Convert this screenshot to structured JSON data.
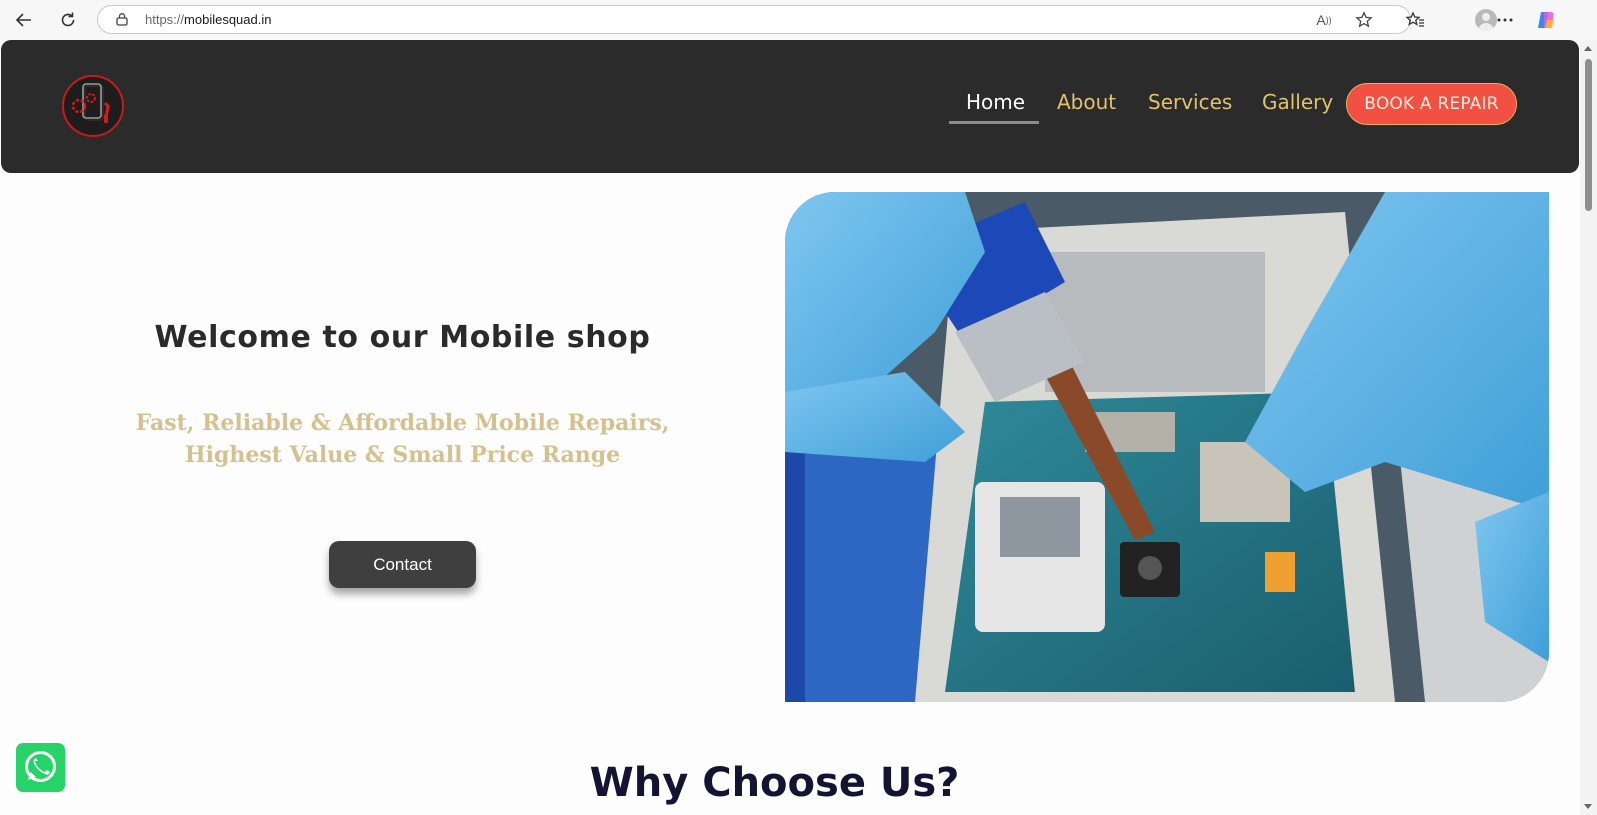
{
  "browser": {
    "url_scheme": "https://",
    "url_host": "mobilesquad.in",
    "icons": [
      "back-icon",
      "reload-icon",
      "lock-icon",
      "read-aloud-icon",
      "favorite-star-icon",
      "favorites-icon",
      "profile-icon",
      "more-icon",
      "copilot-icon"
    ]
  },
  "nav": {
    "items": [
      {
        "label": "Home",
        "active": true
      },
      {
        "label": "About"
      },
      {
        "label": "Services"
      },
      {
        "label": "Gallery"
      }
    ],
    "cta": "BOOK A REPAIR"
  },
  "hero": {
    "title": "Welcome to our Mobile shop",
    "subtitle_line1": "Fast, Reliable & Affordable Mobile Repairs,",
    "subtitle_line2": "Highest Value & Small Price Range",
    "button": "Contact"
  },
  "sections": {
    "why_title": "Why Choose Us?"
  },
  "colors": {
    "header_bg": "#2b2b2b",
    "nav_link": "#e2c26e",
    "cta_bg": "#f25042",
    "subtitle": "#d5c18e",
    "section_title": "#161233",
    "whatsapp": "#25d366"
  }
}
